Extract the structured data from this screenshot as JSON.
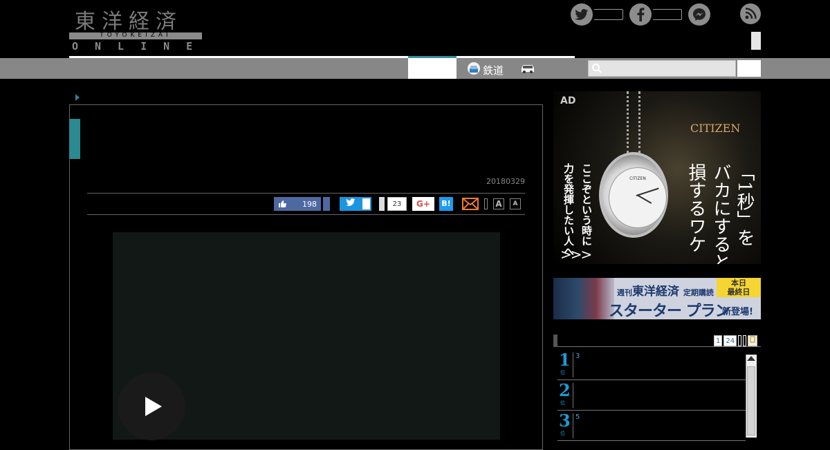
{
  "header": {
    "logo_jp": "東洋経済",
    "logo_roman": "TOYOKEIZAI",
    "logo_online": "ONLINE",
    "social_icons": [
      "twitter-icon",
      "facebook-icon",
      "messenger-icon",
      "rss-icon"
    ]
  },
  "nav": {
    "rail_label": "鉄道",
    "rail_icon": "train-icon",
    "car_icon": "car-icon",
    "search_icon": "search-icon",
    "accent_color": "#3a8f97"
  },
  "article": {
    "date": "20180329",
    "like_count": "198",
    "share_count": "23",
    "gplus_label": "G+",
    "hatena_label": "B!",
    "font_large": "A",
    "font_small": "A",
    "play_icon": "play-icon"
  },
  "ad": {
    "label": "AD",
    "brand": "CITIZEN",
    "watch_brand": "CITIZEN",
    "headline_1": "「1秒」を",
    "headline_2": "バカにすると",
    "headline_3": "損するワケ",
    "sub_1": "ここぞという時に",
    "sub_2": "力を発揮したい人へ",
    "arrows": ">>>"
  },
  "banner": {
    "weekly": "週刊",
    "brand": "東洋経済",
    "subscribe": "定期購読",
    "plan": "スターター プラン",
    "badge_1": "本日",
    "badge_2": "最終日",
    "new": "新登場!"
  },
  "ranking": {
    "tabs": [
      "1",
      "24"
    ],
    "rows": [
      {
        "rank": "1",
        "unit": "位",
        "text": "3"
      },
      {
        "rank": "2",
        "unit": "位",
        "text": ""
      },
      {
        "rank": "3",
        "unit": "位",
        "text": "5"
      }
    ]
  }
}
